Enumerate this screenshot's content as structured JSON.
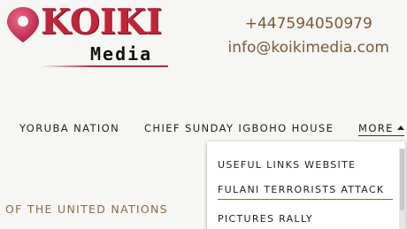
{
  "logo": {
    "word": "KOIKI",
    "sub": "Media",
    "brand_color": "#c2243a",
    "icon": "map-pin-icon"
  },
  "contact": {
    "phone": "+447594050979",
    "email": "info@koikimedia.com",
    "color": "#7a5a38"
  },
  "nav": {
    "items": [
      {
        "label": "YORUBA NATION"
      },
      {
        "label": "CHIEF SUNDAY IGBOHO HOUSE"
      }
    ],
    "more_label": "MORE"
  },
  "dropdown": {
    "items": [
      {
        "label": "USEFUL LINKS WEBSITE"
      },
      {
        "label": "FULANI TERRORISTS ATTACK"
      },
      {
        "label": "PICTURES RALLY"
      }
    ]
  },
  "content": {
    "heading_fragment": "OF THE UNITED NATIONS"
  }
}
